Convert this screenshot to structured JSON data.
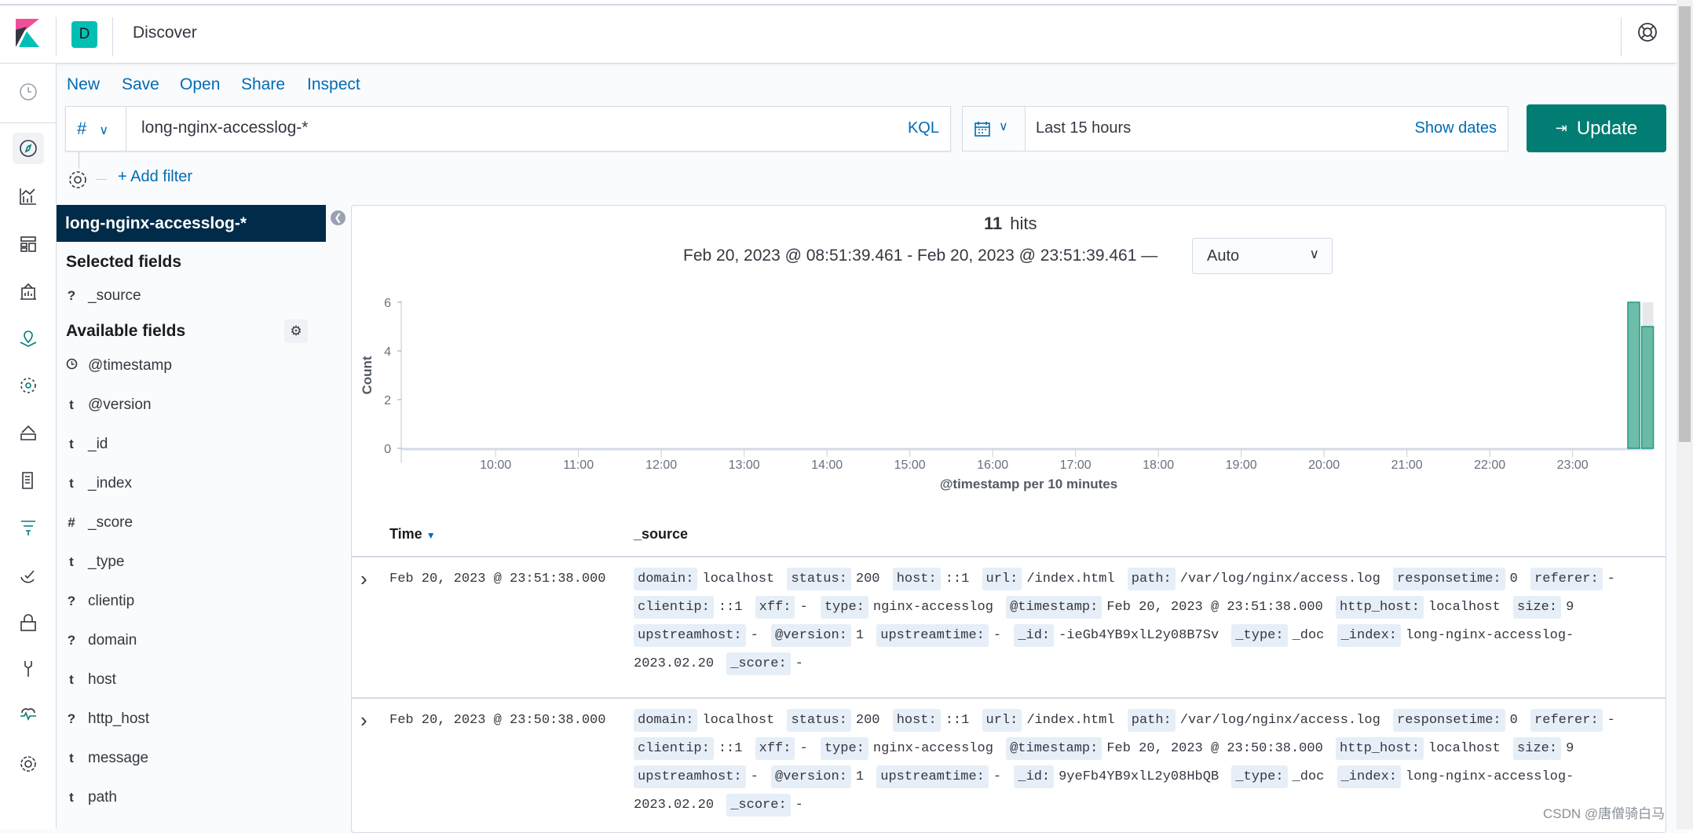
{
  "header": {
    "app_title": "Discover",
    "space_initial": "D"
  },
  "toolbar": {
    "links": [
      "New",
      "Save",
      "Open",
      "Share",
      "Inspect"
    ]
  },
  "query": {
    "prefix": "#",
    "value": "long-nginx-accesslog-*",
    "language": "KQL"
  },
  "date": {
    "value": "Last 15 hours",
    "show_dates": "Show dates",
    "update": "Update"
  },
  "filter": {
    "add_filter": "+ Add filter"
  },
  "sidebar": {
    "index_pattern": "long-nginx-accesslog-*",
    "selected_title": "Selected fields",
    "selected": [
      {
        "type": "?",
        "name": "_source"
      }
    ],
    "available_title": "Available fields",
    "available": [
      {
        "type": "clock",
        "name": "@timestamp"
      },
      {
        "type": "t",
        "name": "@version"
      },
      {
        "type": "t",
        "name": "_id"
      },
      {
        "type": "t",
        "name": "_index"
      },
      {
        "type": "#",
        "name": "_score"
      },
      {
        "type": "t",
        "name": "_type"
      },
      {
        "type": "?",
        "name": "clientip"
      },
      {
        "type": "?",
        "name": "domain"
      },
      {
        "type": "t",
        "name": "host"
      },
      {
        "type": "?",
        "name": "http_host"
      },
      {
        "type": "t",
        "name": "message"
      },
      {
        "type": "t",
        "name": "path"
      }
    ]
  },
  "summary": {
    "hits_count": "11",
    "hits_label": "hits",
    "range": "Feb 20, 2023 @ 08:51:39.461 - Feb 20, 2023 @ 23:51:39.461 —",
    "interval": "Auto"
  },
  "chart_data": {
    "type": "bar",
    "xlabel": "@timestamp per 10 minutes",
    "ylabel": "Count",
    "xlim": [
      "08:51:39.461",
      "23:51:39.461"
    ],
    "ylim": [
      0,
      6
    ],
    "yticks": [
      "0",
      "2",
      "4",
      "6"
    ],
    "xticks": [
      "10:00",
      "11:00",
      "12:00",
      "13:00",
      "14:00",
      "15:00",
      "16:00",
      "17:00",
      "18:00",
      "19:00",
      "20:00",
      "21:00",
      "22:00",
      "23:00"
    ],
    "bars": [
      {
        "x": "23:40",
        "value": 6
      },
      {
        "x": "23:50",
        "value": 5
      }
    ],
    "color": "#54b399"
  },
  "table": {
    "headers": {
      "time": "Time",
      "source": "_source"
    },
    "rows": [
      {
        "time": "Feb 20, 2023 @ 23:51:38.000",
        "fields": [
          [
            "domain:",
            "localhost"
          ],
          [
            "status:",
            "200"
          ],
          [
            "host:",
            "::1"
          ],
          [
            "url:",
            "/index.html"
          ],
          [
            "path:",
            "/var/log/nginx/access.log"
          ],
          [
            "responsetime:",
            "0"
          ],
          [
            "referer:",
            "-"
          ],
          [
            "clientip:",
            "::1"
          ],
          [
            "xff:",
            "-"
          ],
          [
            "type:",
            "nginx-accesslog"
          ],
          [
            "@timestamp:",
            "Feb 20, 2023 @ 23:51:38.000"
          ],
          [
            "http_host:",
            "localhost"
          ],
          [
            "size:",
            "9"
          ],
          [
            "upstreamhost:",
            "-"
          ],
          [
            "@version:",
            "1"
          ],
          [
            "upstreamtime:",
            "-"
          ],
          [
            "_id:",
            "-ieGb4YB9xlL2y08B7Sv"
          ],
          [
            "_type:",
            "_doc"
          ],
          [
            "_index:",
            "long-nginx-accesslog-2023.02.20"
          ],
          [
            "_score:",
            "-"
          ]
        ]
      },
      {
        "time": "Feb 20, 2023 @ 23:50:38.000",
        "fields": [
          [
            "domain:",
            "localhost"
          ],
          [
            "status:",
            "200"
          ],
          [
            "host:",
            "::1"
          ],
          [
            "url:",
            "/index.html"
          ],
          [
            "path:",
            "/var/log/nginx/access.log"
          ],
          [
            "responsetime:",
            "0"
          ],
          [
            "referer:",
            "-"
          ],
          [
            "clientip:",
            "::1"
          ],
          [
            "xff:",
            "-"
          ],
          [
            "type:",
            "nginx-accesslog"
          ],
          [
            "@timestamp:",
            "Feb 20, 2023 @ 23:50:38.000"
          ],
          [
            "http_host:",
            "localhost"
          ],
          [
            "size:",
            "9"
          ],
          [
            "upstreamhost:",
            "-"
          ],
          [
            "@version:",
            "1"
          ],
          [
            "upstreamtime:",
            "-"
          ],
          [
            "_id:",
            "9yeFb4YB9xlL2y08HbQB"
          ],
          [
            "_type:",
            "_doc"
          ],
          [
            "_index:",
            "long-nginx-accesslog-2023.02.20"
          ],
          [
            "_score:",
            "-"
          ]
        ]
      }
    ]
  },
  "watermark": "CSDN @唐僧骑白马"
}
